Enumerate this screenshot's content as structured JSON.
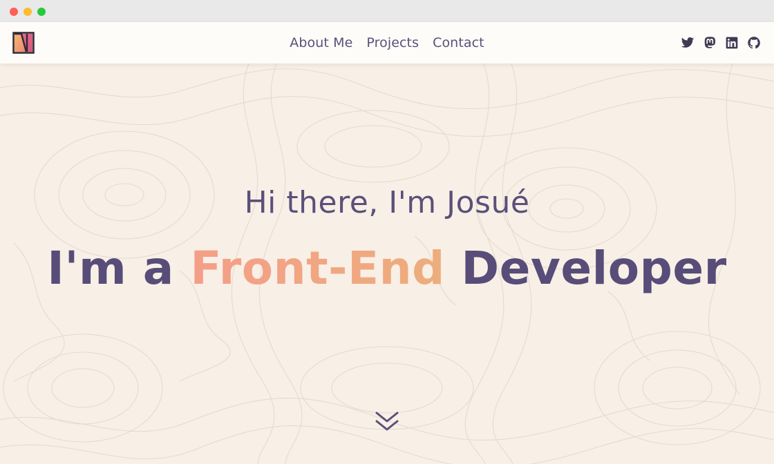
{
  "nav": {
    "links": [
      {
        "label": "About Me"
      },
      {
        "label": "Projects"
      },
      {
        "label": "Contact"
      }
    ],
    "socials": [
      "twitter-icon",
      "mastodon-icon",
      "linkedin-icon",
      "github-icon"
    ]
  },
  "hero": {
    "greeting": "Hi there, I'm Josué",
    "headline_prefix": "I'm a",
    "headline_highlight": "Front-End",
    "headline_suffix": "Developer"
  },
  "colors": {
    "primary": "#574d78",
    "accent_start": "#f59e88",
    "accent_end": "#ecae7c",
    "background": "#f8efe7",
    "navbar": "#fefcf8"
  }
}
